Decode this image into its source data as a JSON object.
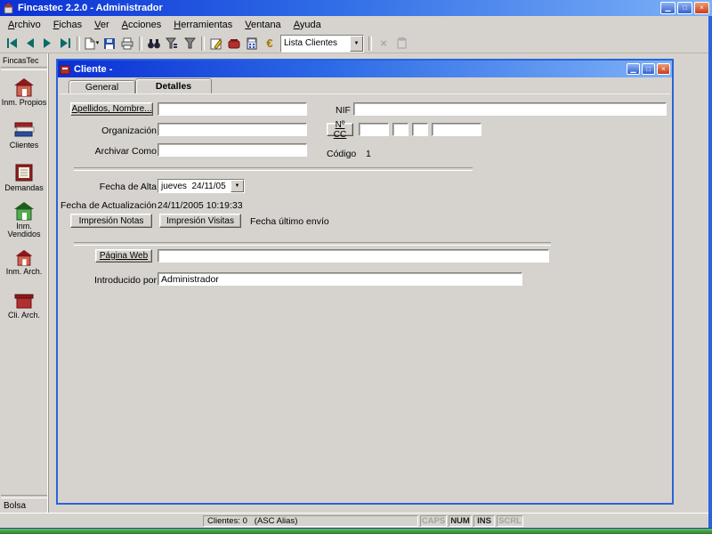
{
  "window": {
    "title": "Fincastec 2.2.0 - Administrador"
  },
  "glyphs": {
    "minimize": "▁",
    "maximize": "□",
    "close": "×",
    "dropdown": "▼",
    "caret": "▾"
  },
  "menu": {
    "items": [
      "Archivo",
      "Fichas",
      "Ver",
      "Acciones",
      "Herramientas",
      "Ventana",
      "Ayuda"
    ]
  },
  "toolbar": {
    "list_combo_value": "Lista Clientes",
    "euro_glyph": "€",
    "delete_glyph": "×",
    "icons": [
      "first-record",
      "previous-record",
      "next-record",
      "last-record",
      "new-record",
      "save",
      "print",
      "find",
      "filter-by-form",
      "filter",
      "edit-form",
      "contacts",
      "calculator",
      "euro",
      "record-list",
      "delete",
      "export"
    ]
  },
  "sidebar": {
    "header": "FincasTec",
    "items": [
      {
        "label": "Inm. Propios",
        "icon": "red-house"
      },
      {
        "label": "Clientes",
        "icon": "books"
      },
      {
        "label": "Demandas",
        "icon": "ledger"
      },
      {
        "label": "Inm. Vendidos",
        "icon": "green-house"
      },
      {
        "label": "Inm. Arch.",
        "icon": "red-house"
      },
      {
        "label": "Cli. Arch.",
        "icon": "red-box"
      }
    ],
    "footer": "Bolsa"
  },
  "client_window": {
    "title": "Cliente -",
    "tabs": [
      {
        "label": "General"
      },
      {
        "label": "Detalles"
      }
    ],
    "fields": {
      "apellidos_button": "Apellidos, Nombre...",
      "apellidos_value": "",
      "organizacion_label": "Organización",
      "organizacion_value": "",
      "archivar_label": "Archivar Como",
      "archivar_value": "",
      "nif_label": "NIF",
      "nif_value": "",
      "ncc_button": "Nº CC",
      "ncc_values": [
        "",
        "",
        "",
        ""
      ],
      "codigo_label": "Código",
      "codigo_value": "1",
      "fecha_alta_label": "Fecha de Alta",
      "fecha_alta_value": "jueves  24/11/05",
      "fecha_actualizacion_label": "Fecha de Actualización",
      "fecha_actualizacion_value": "24/11/2005 10:19:33",
      "impresion_notas_button": "Impresión Notas",
      "impresion_visitas_button": "Impresión Visitas",
      "fecha_ultimo_envio_label": "Fecha último envío",
      "pagina_web_button": "Página Web",
      "pagina_web_value": "",
      "introducido_por_label": "Introducido por",
      "introducido_por_value": "Administrador"
    }
  },
  "statusbar": {
    "message": "Clientes: 0   (ASC Alias)",
    "indicators": [
      {
        "label": "CAPS",
        "active": false
      },
      {
        "label": "NUM",
        "active": true
      },
      {
        "label": "INS",
        "active": true
      },
      {
        "label": "SCRL",
        "active": false
      }
    ]
  },
  "colors": {
    "title_gradient_start": "#0b2fd4",
    "title_gradient_end": "#7db1f7",
    "close_button": "#c63f18",
    "window_border_blue": "#2b63d8",
    "taskbar_green": "#2a7c2d",
    "nav_arrow_teal": "#0c6a6a"
  }
}
